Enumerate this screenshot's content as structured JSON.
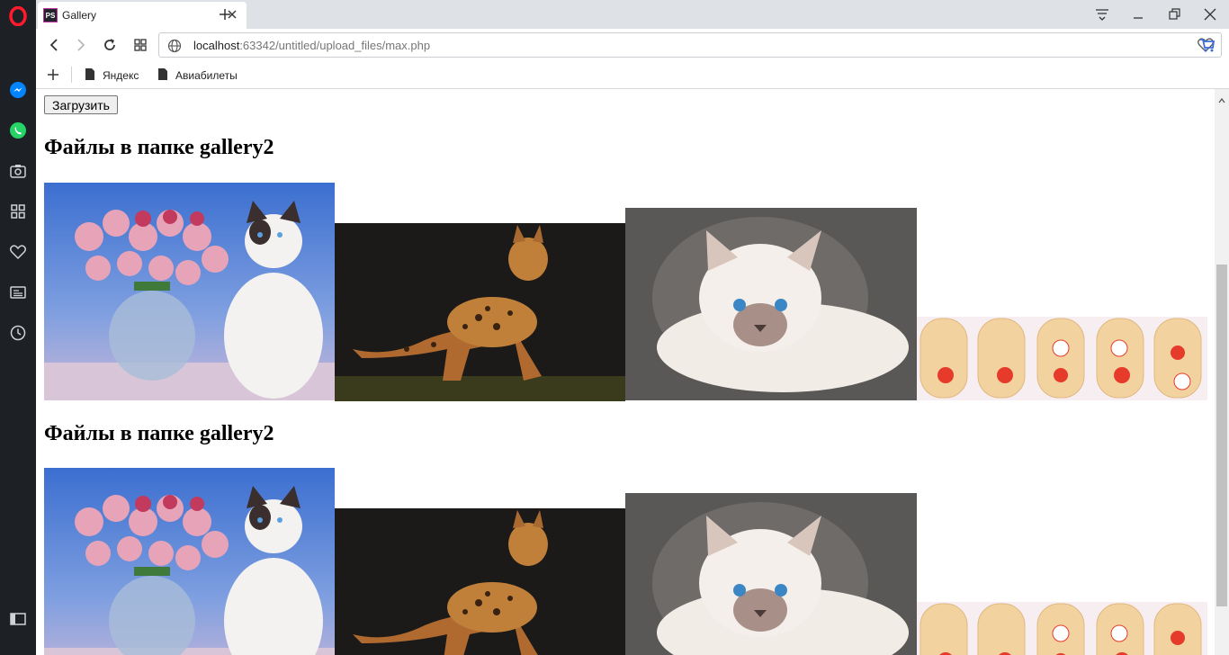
{
  "browser": {
    "tab": {
      "favicon": "PS",
      "title": "Gallery"
    },
    "url": {
      "host": "localhost",
      "rest": ":63342/untitled/upload_files/max.php"
    },
    "bookmarks": [
      {
        "label": "Яндекс",
        "icon": "page-icon"
      },
      {
        "label": "Авиабилеты",
        "icon": "page-icon"
      }
    ],
    "sidebar_icons": [
      "opera-logo-icon",
      "messenger-icon",
      "whatsapp-icon",
      "camera-icon",
      "speed-dial-icon",
      "heart-icon",
      "news-icon",
      "history-icon",
      "sidebar-toggle-icon"
    ]
  },
  "page": {
    "upload_label": "Загрузить",
    "sections": [
      {
        "heading": "Файлы в папке gallery2",
        "images": [
          "cat-with-tulips",
          "bengal-cat",
          "birman-cat",
          "nail-art-flowers"
        ]
      },
      {
        "heading": "Файлы в папке gallery2",
        "images": [
          "cat-with-tulips",
          "bengal-cat",
          "birman-cat",
          "nail-art-flowers"
        ]
      }
    ]
  },
  "colors": {
    "sidebar": "#1d2024",
    "opera_red": "#ff1b2d",
    "whatsapp": "#25d366",
    "messenger": "#0084ff",
    "cart": "#3b6fd8"
  }
}
